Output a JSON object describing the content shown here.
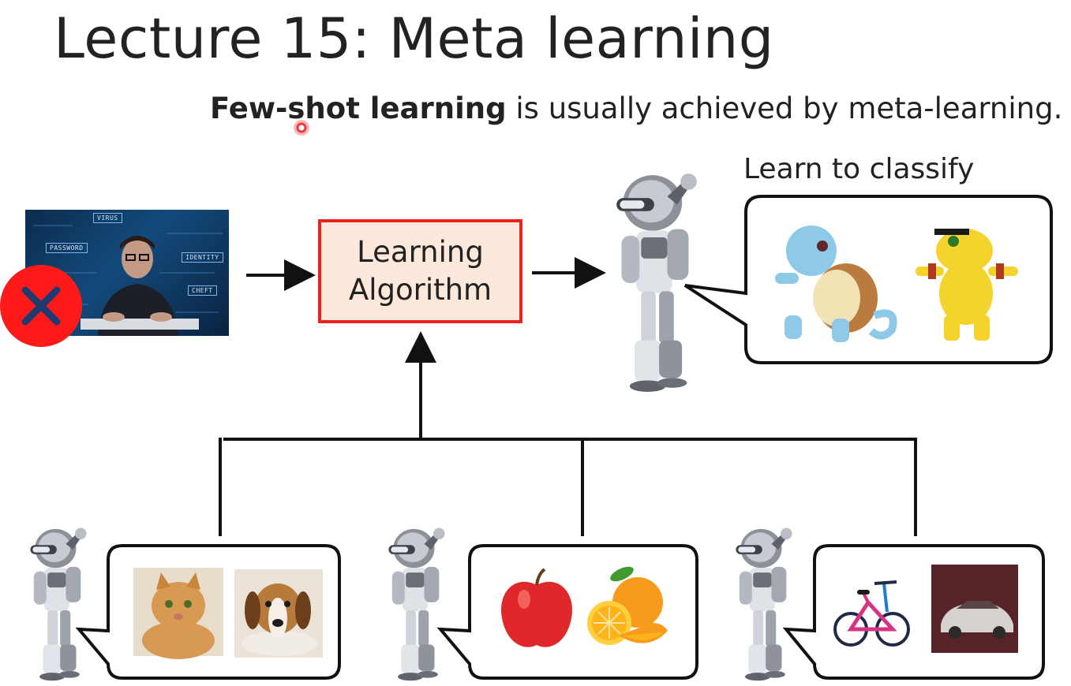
{
  "slide": {
    "title": "Lecture 15: Meta learning",
    "subtitle_bold": "Few-shot learning",
    "subtitle_rest": " is usually achieved by meta-learning.",
    "learn_label": "Learn to classify",
    "algorithm_line1": "Learning",
    "algorithm_line2": "Algorithm"
  },
  "photo": {
    "tags": [
      "PASSWORD",
      "IDENTITY",
      "CHEFT",
      "VIRUS"
    ]
  },
  "colors": {
    "algo_fill": "#fde8dc",
    "algo_border": "#e8251d",
    "badge_red": "#ff1a1a"
  },
  "icons": {
    "person_photo": "hacker-photo-icon",
    "forbidden": "no-x-badge-icon",
    "robot": "robot-icon",
    "target_classes": [
      "squirtle-icon",
      "agumon-icon"
    ],
    "task1": [
      "cat-photo-icon",
      "dog-photo-icon"
    ],
    "task2": [
      "apple-icon",
      "orange-icon"
    ],
    "task3": [
      "bicycle-icon",
      "car-photo-icon"
    ]
  }
}
